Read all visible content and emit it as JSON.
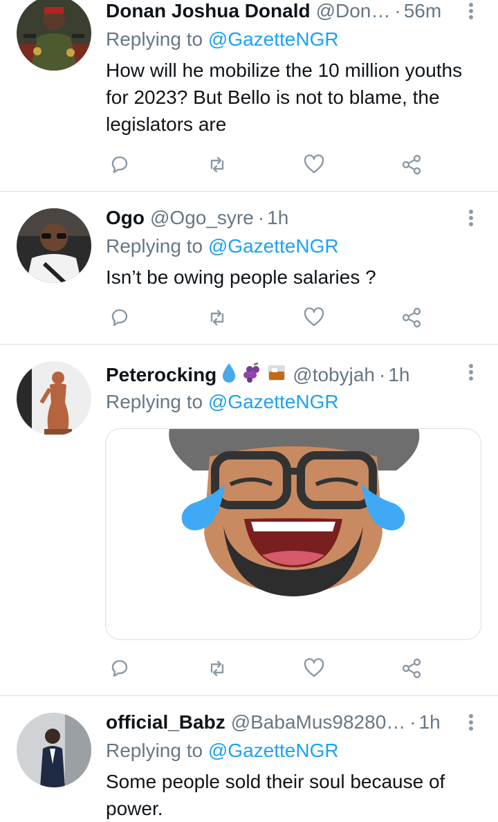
{
  "tweets": [
    {
      "name": "Donan Joshua Donald",
      "handle": "@Don…",
      "sep": "·",
      "time": "56m",
      "replying_prefix": "Replying to",
      "replying_to": "@GazetteNGR",
      "text": "How will he mobilize the 10 million youths for 2023? But Bello is not to blame, the legislators are"
    },
    {
      "name": "Ogo",
      "handle": "@Ogo_syre",
      "sep": "·",
      "time": "1h",
      "replying_prefix": "Replying to",
      "replying_to": "@GazetteNGR",
      "text": "Isn’t be owing people salaries ?"
    },
    {
      "name": "Peterocking",
      "name_emojis": [
        "droplet-emoji",
        "grapes-emoji",
        "tumbler-glass-emoji"
      ],
      "handle": "@tobyjah",
      "sep": "·",
      "time": "1h",
      "replying_prefix": "Replying to",
      "replying_to": "@GazetteNGR",
      "media": "laughing-memoji-sticker"
    },
    {
      "name": "official_Babz",
      "handle": "@BabaMus98280…",
      "sep": "·",
      "time": "1h",
      "replying_prefix": "Replying to",
      "replying_to": "@GazetteNGR",
      "text": "Some people sold their soul because of power."
    }
  ],
  "actions": [
    "reply-icon",
    "retweet-icon",
    "like-icon",
    "share-icon"
  ],
  "colors": {
    "mention": "#1da1f2",
    "secondary": "#657786",
    "icon": "#8b98a5",
    "divider": "#d9dde0"
  }
}
